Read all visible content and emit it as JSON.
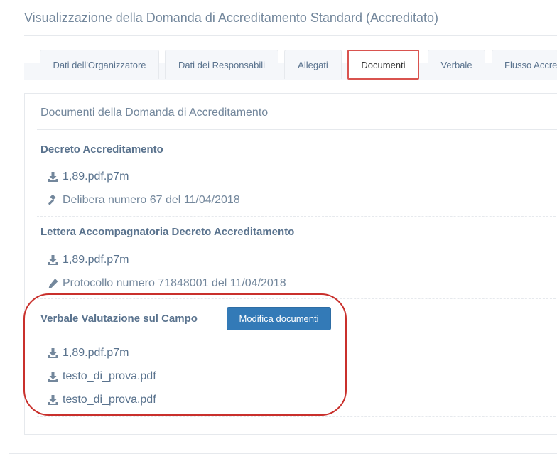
{
  "page": {
    "title": "Visualizzazione della Domanda di Accreditamento Standard (Accreditato)"
  },
  "tabs": [
    {
      "label": "Dati dell'Organizzatore",
      "active": false
    },
    {
      "label": "Dati dei Responsabili",
      "active": false
    },
    {
      "label": "Allegati",
      "active": false
    },
    {
      "label": "Documenti",
      "active": true
    },
    {
      "label": "Verbale",
      "active": false
    },
    {
      "label": "Flusso Accre",
      "active": false
    }
  ],
  "panel": {
    "title": "Documenti della Domanda di Accreditamento"
  },
  "sections": [
    {
      "title": "Decreto Accreditamento",
      "file": {
        "icon": "download-icon",
        "name": "1,89.pdf.p7m"
      },
      "info": {
        "icon": "gavel-icon",
        "text": "Delibera numero 67 del 11/04/2018"
      }
    },
    {
      "title": "Lettera Accompagnatoria Decreto Accreditamento",
      "file": {
        "icon": "download-icon",
        "name": "1,89.pdf.p7m"
      },
      "info": {
        "icon": "pencil-icon",
        "text": "Protocollo numero 71848001 del 11/04/2018"
      }
    },
    {
      "title": "Verbale Valutazione sul Campo",
      "button_label": "Modifica documenti",
      "files": [
        {
          "icon": "download-icon",
          "name": "1,89.pdf.p7m"
        },
        {
          "icon": "download-icon",
          "name": "testo_di_prova.pdf"
        },
        {
          "icon": "download-icon",
          "name": "testo_di_prova.pdf"
        }
      ]
    }
  ],
  "colors": {
    "accent": "#337ab7",
    "highlight": "#c9302c",
    "text": "#73879c",
    "heading": "#5a738e"
  }
}
